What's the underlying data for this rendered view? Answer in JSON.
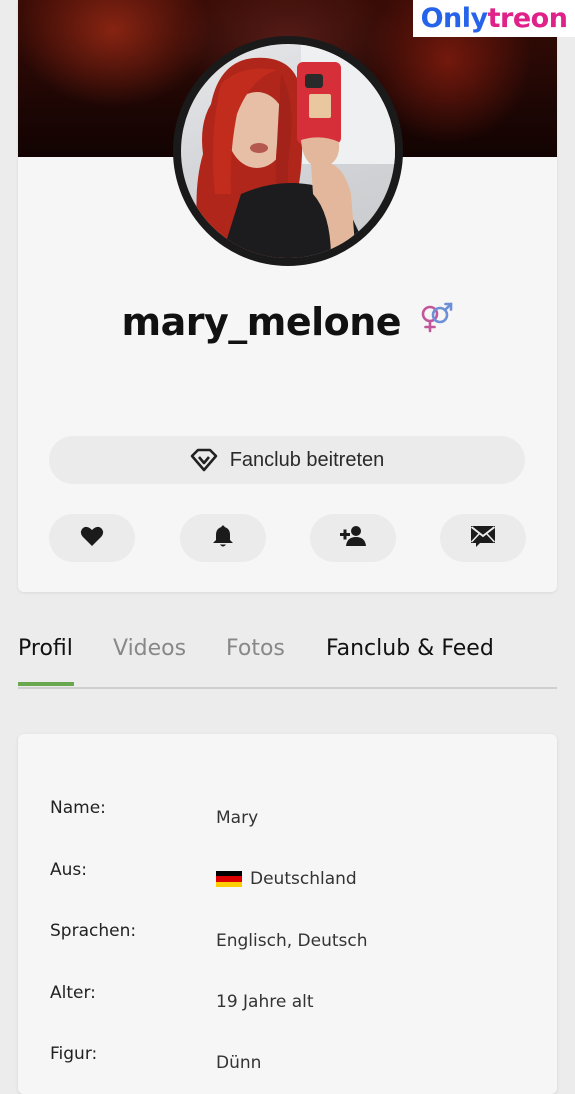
{
  "profile": {
    "username": "mary_melone",
    "gender_icon": "male-female-symbol-icon",
    "fanclub_button": "Fanclub beitreten",
    "actions": [
      {
        "name": "like",
        "icon": "heart-icon"
      },
      {
        "name": "notify",
        "icon": "bell-icon"
      },
      {
        "name": "follow",
        "icon": "add-user-icon"
      },
      {
        "name": "message",
        "icon": "envelope-icon"
      }
    ]
  },
  "tabs": [
    {
      "label": "Profil",
      "active": true
    },
    {
      "label": "Videos",
      "active": false
    },
    {
      "label": "Fotos",
      "active": false
    },
    {
      "label": "Fanclub & Feed",
      "active": false
    }
  ],
  "info": [
    {
      "label": "Name:",
      "value": "Mary"
    },
    {
      "label": "Aus:",
      "value": "Deutschland",
      "flag": "germany-flag"
    },
    {
      "label": "Sprachen:",
      "value": "Englisch, Deutsch"
    },
    {
      "label": "Alter:",
      "value": "19 Jahre alt"
    },
    {
      "label": "Figur:",
      "value": "Dünn"
    }
  ],
  "watermark": {
    "part1": "Only",
    "part2": "treon"
  },
  "colors": {
    "accent_tab": "#6aa84f",
    "button_bg": "#ebebeb",
    "card_bg": "#f6f6f6",
    "page_bg": "#ececec",
    "gender_icon": "#c2569a"
  }
}
